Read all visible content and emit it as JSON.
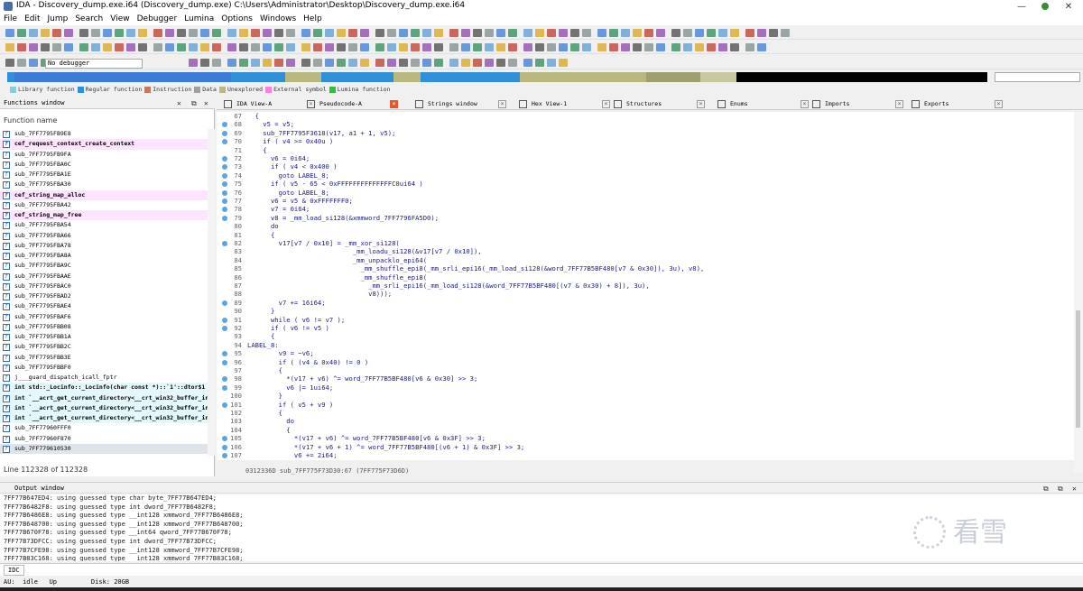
{
  "title": "IDA - Discovery_dump.exe.i64 (Discovery_dump.exe) C:\\Users\\Administrator\\Desktop\\Discovery_dump.exe.i64",
  "menu": [
    "File",
    "Edit",
    "Jump",
    "Search",
    "View",
    "Debugger",
    "Lumina",
    "Options",
    "Windows",
    "Help"
  ],
  "debugger_select": "No debugger",
  "legend": [
    {
      "label": "Library function",
      "color": "#7fd0e0"
    },
    {
      "label": "Regular function",
      "color": "#2f8fd8"
    },
    {
      "label": "Instruction",
      "color": "#c07a60"
    },
    {
      "label": "Data",
      "color": "#a0a0a0"
    },
    {
      "label": "Unexplored",
      "color": "#b8b880"
    },
    {
      "label": "External symbol",
      "color": "#ff7fd8"
    },
    {
      "label": "Lumina function",
      "color": "#30c040"
    }
  ],
  "functions": {
    "panel_title": "Functions window",
    "column": "Function name",
    "items": [
      {
        "name": "sub_7FF7795FB9E8",
        "style": ""
      },
      {
        "name": "cef_request_context_create_context",
        "style": "pink"
      },
      {
        "name": "sub_7FF7795FB9FA",
        "style": ""
      },
      {
        "name": "sub_7FF7795FBA0C",
        "style": ""
      },
      {
        "name": "sub_7FF7795FBA1E",
        "style": ""
      },
      {
        "name": "sub_7FF7795FBA30",
        "style": ""
      },
      {
        "name": "cef_string_map_alloc",
        "style": "pink"
      },
      {
        "name": "sub_7FF7795FBA42",
        "style": ""
      },
      {
        "name": "cef_string_map_free",
        "style": "pink"
      },
      {
        "name": "sub_7FF7795FBA54",
        "style": ""
      },
      {
        "name": "sub_7FF7795FBA66",
        "style": ""
      },
      {
        "name": "sub_7FF7795FBA78",
        "style": ""
      },
      {
        "name": "sub_7FF7795FBA8A",
        "style": ""
      },
      {
        "name": "sub_7FF7795FBA9C",
        "style": ""
      },
      {
        "name": "sub_7FF7795FBAAE",
        "style": ""
      },
      {
        "name": "sub_7FF7795FBAC0",
        "style": ""
      },
      {
        "name": "sub_7FF7795FBAD2",
        "style": ""
      },
      {
        "name": "sub_7FF7795FBAE4",
        "style": ""
      },
      {
        "name": "sub_7FF7795FBAF6",
        "style": ""
      },
      {
        "name": "sub_7FF7795FBB08",
        "style": ""
      },
      {
        "name": "sub_7FF7795FBB1A",
        "style": ""
      },
      {
        "name": "sub_7FF7795FBB2C",
        "style": ""
      },
      {
        "name": "sub_7FF7795FBB3E",
        "style": ""
      },
      {
        "name": "sub_7FF7795FBBF0",
        "style": ""
      },
      {
        "name": "j___guard_dispatch_icall_fptr",
        "style": ""
      },
      {
        "name": "int std::_Locinfo::_Locinfo(char const *)::`1'::dtor$1",
        "style": "cyan"
      },
      {
        "name": "int `__acrt_get_current_directory<__crt_win32_buffer_internal_d...",
        "style": "cyan"
      },
      {
        "name": "int `__acrt_get_current_directory<__crt_win32_buffer_internal_d...",
        "style": "cyan"
      },
      {
        "name": "int `__acrt_get_current_directory<__crt_win32_buffer_internal_d...",
        "style": "cyan"
      },
      {
        "name": "sub_7FF77960FFF0",
        "style": ""
      },
      {
        "name": "sub_7FF77960F870",
        "style": ""
      },
      {
        "name": "sub_7FF779610530",
        "style": "sel"
      }
    ],
    "status": "Line 112328 of 112328"
  },
  "tabs": [
    {
      "label": "IDA View-A",
      "active": false
    },
    {
      "label": "Pseudocode-A",
      "active": true
    },
    {
      "label": "Strings window",
      "active": false
    },
    {
      "label": "Hex View-1",
      "active": false
    },
    {
      "label": "Structures",
      "active": false
    },
    {
      "label": "Enums",
      "active": false
    },
    {
      "label": "Imports",
      "active": false
    },
    {
      "label": "Exports",
      "active": false
    }
  ],
  "code": [
    {
      "n": "67",
      "dot": false,
      "t": "  {"
    },
    {
      "n": "68",
      "dot": true,
      "t": "    v5 = v5;"
    },
    {
      "n": "69",
      "dot": true,
      "t": "    sub_7FF7795F3618(v17, a1 + 1, v5);"
    },
    {
      "n": "70",
      "dot": true,
      "t": "    if ( v4 >= 0x40u )"
    },
    {
      "n": "71",
      "dot": false,
      "t": "    {"
    },
    {
      "n": "72",
      "dot": true,
      "t": "      v6 = 0i64;"
    },
    {
      "n": "73",
      "dot": true,
      "t": "      if ( v4 < 0x400 )"
    },
    {
      "n": "74",
      "dot": true,
      "t": "        goto LABEL_8;"
    },
    {
      "n": "75",
      "dot": true,
      "t": "      if ( v5 - 65 < 0xFFFFFFFFFFFFFFC0ui64 )"
    },
    {
      "n": "76",
      "dot": true,
      "t": "        goto LABEL_8;"
    },
    {
      "n": "77",
      "dot": true,
      "t": "      v6 = v5 & 0xFFFFFFF0;"
    },
    {
      "n": "78",
      "dot": true,
      "t": "      v7 = 0i64;"
    },
    {
      "n": "79",
      "dot": true,
      "t": "      v8 = _mm_load_si128(&xmmword_7FF7796FA5D0);"
    },
    {
      "n": "80",
      "dot": false,
      "t": "      do"
    },
    {
      "n": "81",
      "dot": false,
      "t": "      {"
    },
    {
      "n": "82",
      "dot": true,
      "t": "        v17[v7 / 0x10] = _mm_xor_si128("
    },
    {
      "n": "83",
      "dot": false,
      "t": "                           _mm_loadu_si128(&v17[v7 / 0x10]),"
    },
    {
      "n": "84",
      "dot": false,
      "t": "                           _mm_unpacklo_epi64("
    },
    {
      "n": "85",
      "dot": false,
      "t": "                             _mm_shuffle_epi8(_mm_srli_epi16(_mm_load_si128(&word_7FF77B5BF480[v7 & 0x30]), 3u), v8),"
    },
    {
      "n": "86",
      "dot": false,
      "t": "                             _mm_shuffle_epi8("
    },
    {
      "n": "87",
      "dot": false,
      "t": "                               _mm_srli_epi16(_mm_load_si128(&word_7FF77B5BF480[(v7 & 0x30) + 8]), 3u),"
    },
    {
      "n": "88",
      "dot": false,
      "t": "                               v8)));"
    },
    {
      "n": "89",
      "dot": true,
      "t": "        v7 += 16i64;"
    },
    {
      "n": "90",
      "dot": false,
      "t": "      }"
    },
    {
      "n": "91",
      "dot": true,
      "t": "      while ( v6 != v7 );"
    },
    {
      "n": "92",
      "dot": true,
      "t": "      if ( v6 != v5 )"
    },
    {
      "n": "93",
      "dot": false,
      "t": "      {"
    },
    {
      "n": "94",
      "dot": false,
      "t": "LABEL_8:"
    },
    {
      "n": "95",
      "dot": true,
      "t": "        v9 = ~v6;"
    },
    {
      "n": "96",
      "dot": true,
      "t": "        if ( (v4 & 0x40) != 0 )"
    },
    {
      "n": "97",
      "dot": false,
      "t": "        {"
    },
    {
      "n": "98",
      "dot": true,
      "t": "          *(v17 + v6) ^= word_7FF77B5BF480[v6 & 0x30] >> 3;"
    },
    {
      "n": "99",
      "dot": true,
      "t": "          v6 |= 1ui64;"
    },
    {
      "n": "100",
      "dot": false,
      "t": "        }"
    },
    {
      "n": "101",
      "dot": true,
      "t": "        if ( v5 + v9 )"
    },
    {
      "n": "102",
      "dot": false,
      "t": "        {"
    },
    {
      "n": "103",
      "dot": false,
      "t": "          do"
    },
    {
      "n": "104",
      "dot": false,
      "t": "          {"
    },
    {
      "n": "105",
      "dot": true,
      "t": "            *(v17 + v6) ^= word_7FF77B5BF480[v6 & 0x3F] >> 3;"
    },
    {
      "n": "106",
      "dot": true,
      "t": "            *(v17 + v6 + 1) ^= word_7FF77B5BF480[(v6 + 1) & 0x3F] >> 3;"
    },
    {
      "n": "107",
      "dot": true,
      "t": "            v6 += 2i64;"
    }
  ],
  "code_status": "0312336D sub_7FF775F73D30:67 (7FF775F73D6D)",
  "output": {
    "title": "Output window",
    "lines": [
      "7FF77B647ED4: using guessed type char byte_7FF77B647ED4;",
      "7FF77B6482F8: using guessed type int dword_7FF77B6482F8;",
      "7FF77B6486E8: using guessed type __int128 xmmword_7FF77B6486E8;",
      "7FF77B648700: using guessed type __int128 xmmword_7FF77B648700;",
      "7FF77B670F78: using guessed type __int64 qword_7FF77B670F78;",
      "7FF77B73DFCC: using guessed type int dword_7FF77B73DFCC;",
      "7FF77B7CFE98: using guessed type __int128 xmmword_7FF77B7CFE98;",
      "7FF77B83C168: using guessed type __int128 xmmword_7FF77B83C168;"
    ]
  },
  "idc_label": "IDC",
  "status_bar": "AU:  idle   Up         Disk: 20GB",
  "watermark": "看雪"
}
